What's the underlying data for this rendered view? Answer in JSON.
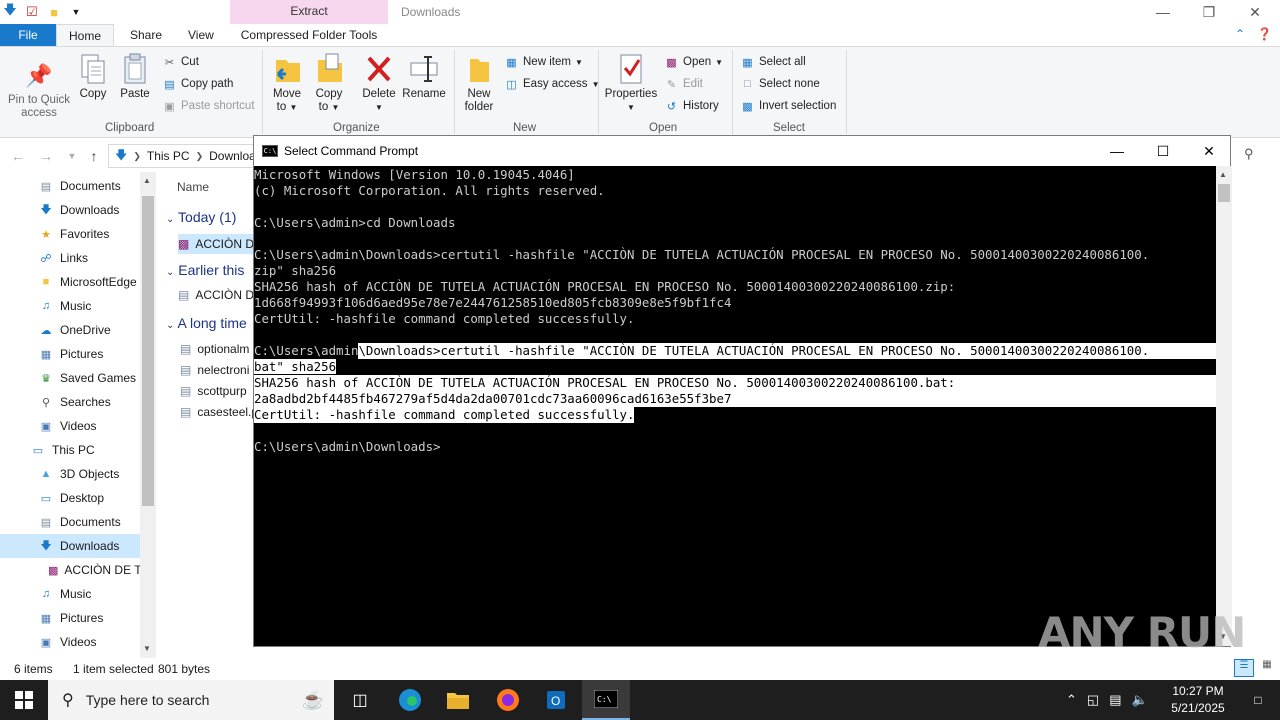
{
  "explorer": {
    "window_title": "Downloads",
    "contextual_tab": "Extract",
    "tabs": [
      "File",
      "Home",
      "Share",
      "View",
      "Compressed Folder Tools"
    ],
    "ribbon": {
      "clipboard": {
        "label": "Clipboard",
        "pin_label_1": "Pin to Quick",
        "pin_label_2": "access",
        "copy": "Copy",
        "paste": "Paste",
        "cut": "Cut",
        "copy_path": "Copy path",
        "paste_shortcut": "Paste shortcut"
      },
      "organize": {
        "label": "Organize",
        "move_to_1": "Move",
        "move_to_2": "to",
        "copy_to_1": "Copy",
        "copy_to_2": "to",
        "delete": "Delete",
        "rename": "Rename"
      },
      "new": {
        "label": "New",
        "new_folder_1": "New",
        "new_folder_2": "folder",
        "new_item": "New item",
        "easy_access": "Easy access"
      },
      "open": {
        "label": "Open",
        "properties": "Properties",
        "open": "Open",
        "edit": "Edit",
        "history": "History"
      },
      "select": {
        "label": "Select",
        "select_all": "Select all",
        "select_none": "Select none",
        "invert_selection": "Invert selection"
      }
    },
    "address": {
      "this_pc": "This PC",
      "downloads": "Downloa"
    },
    "nav_items": [
      {
        "label": "Documents",
        "icon": "documents-icon"
      },
      {
        "label": "Downloads",
        "icon": "downloads-icon"
      },
      {
        "label": "Favorites",
        "icon": "star-icon"
      },
      {
        "label": "Links",
        "icon": "links-icon"
      },
      {
        "label": "MicrosoftEdge",
        "icon": "folder-icon"
      },
      {
        "label": "Music",
        "icon": "music-icon"
      },
      {
        "label": "OneDrive",
        "icon": "onedrive-icon"
      },
      {
        "label": "Pictures",
        "icon": "pictures-icon"
      },
      {
        "label": "Saved Games",
        "icon": "saved-games-icon"
      },
      {
        "label": "Searches",
        "icon": "search-icon"
      },
      {
        "label": "Videos",
        "icon": "videos-icon"
      },
      {
        "label": "This PC",
        "icon": "computer-icon"
      },
      {
        "label": "3D Objects",
        "icon": "3d-objects-icon"
      },
      {
        "label": "Desktop",
        "icon": "desktop-icon"
      },
      {
        "label": "Documents",
        "icon": "documents-icon"
      },
      {
        "label": "Downloads",
        "icon": "downloads-icon"
      },
      {
        "label": "ACCIÒN DE T",
        "icon": "winrar-icon"
      },
      {
        "label": "Music",
        "icon": "music-icon"
      },
      {
        "label": "Pictures",
        "icon": "pictures-icon"
      },
      {
        "label": "Videos",
        "icon": "videos-icon"
      }
    ],
    "file_list": {
      "column_name": "Name",
      "groups": [
        {
          "header": "Today (1)",
          "files": [
            "ACCIÒN D"
          ]
        },
        {
          "header": "Earlier this",
          "files": [
            "ACCIÒN D"
          ]
        },
        {
          "header": "A long time",
          "files": [
            "optionalm",
            "nelectroni",
            "scottpurp",
            "casesteel.p"
          ]
        }
      ]
    },
    "status": {
      "items": "6 items",
      "selected": "1 item selected",
      "size": "801 bytes"
    }
  },
  "cmd": {
    "title": "Select Command Prompt",
    "lines": [
      "Microsoft Windows [Version 10.0.19045.4046]",
      "(c) Microsoft Corporation. All rights reserved.",
      "",
      "C:\\Users\\admin>cd Downloads",
      "",
      "C:\\Users\\admin\\Downloads>certutil -hashfile \"ACCIÒN DE TUTELA ACTUACIÓN PROCESAL EN PROCESO No. 50001400300220240086100.",
      "zip\" sha256",
      "SHA256 hash of ACCIÒN DE TUTELA ACTUACIÓN PROCESAL EN PROCESO No. 50001400300220240086100.zip:",
      "1d668f94993f106d6aed95e78e7e244761258510ed805fcb8309e8e5f9bf1fc4",
      "CertUtil: -hashfile command completed successfully.",
      "",
      "C:\\Users\\admin\\Downloads>certutil -hashfile \"ACCIÒN DE TUTELA ACTUACIÓN PROCESAL EN PROCESO No. 50001400300220240086100.",
      "bat\" sha256",
      "SHA256 hash of ACCIÒN DE TUTELA ACTUACIÓN PROCESAL EN PROCESO No. 50001400300220240086100.bat:",
      "2a8adbd2bf4485fb467279af5d4da2da00701cdc73aa60096cad6163e55f3be7",
      "CertUtil: -hashfile command completed successfully.",
      "",
      "C:\\Users\\admin\\Downloads>"
    ]
  },
  "watermark": "ANY RUN",
  "taskbar": {
    "search_placeholder": "Type here to search",
    "time": "10:27 PM",
    "date": "5/21/2025"
  },
  "colors": {
    "accent": "#1979ca",
    "console_bg": "#000000",
    "console_fg": "#cccccc",
    "selection": "#ffffff",
    "taskbar": "#1e1e1e",
    "extract_tab": "#f7d7ee"
  }
}
